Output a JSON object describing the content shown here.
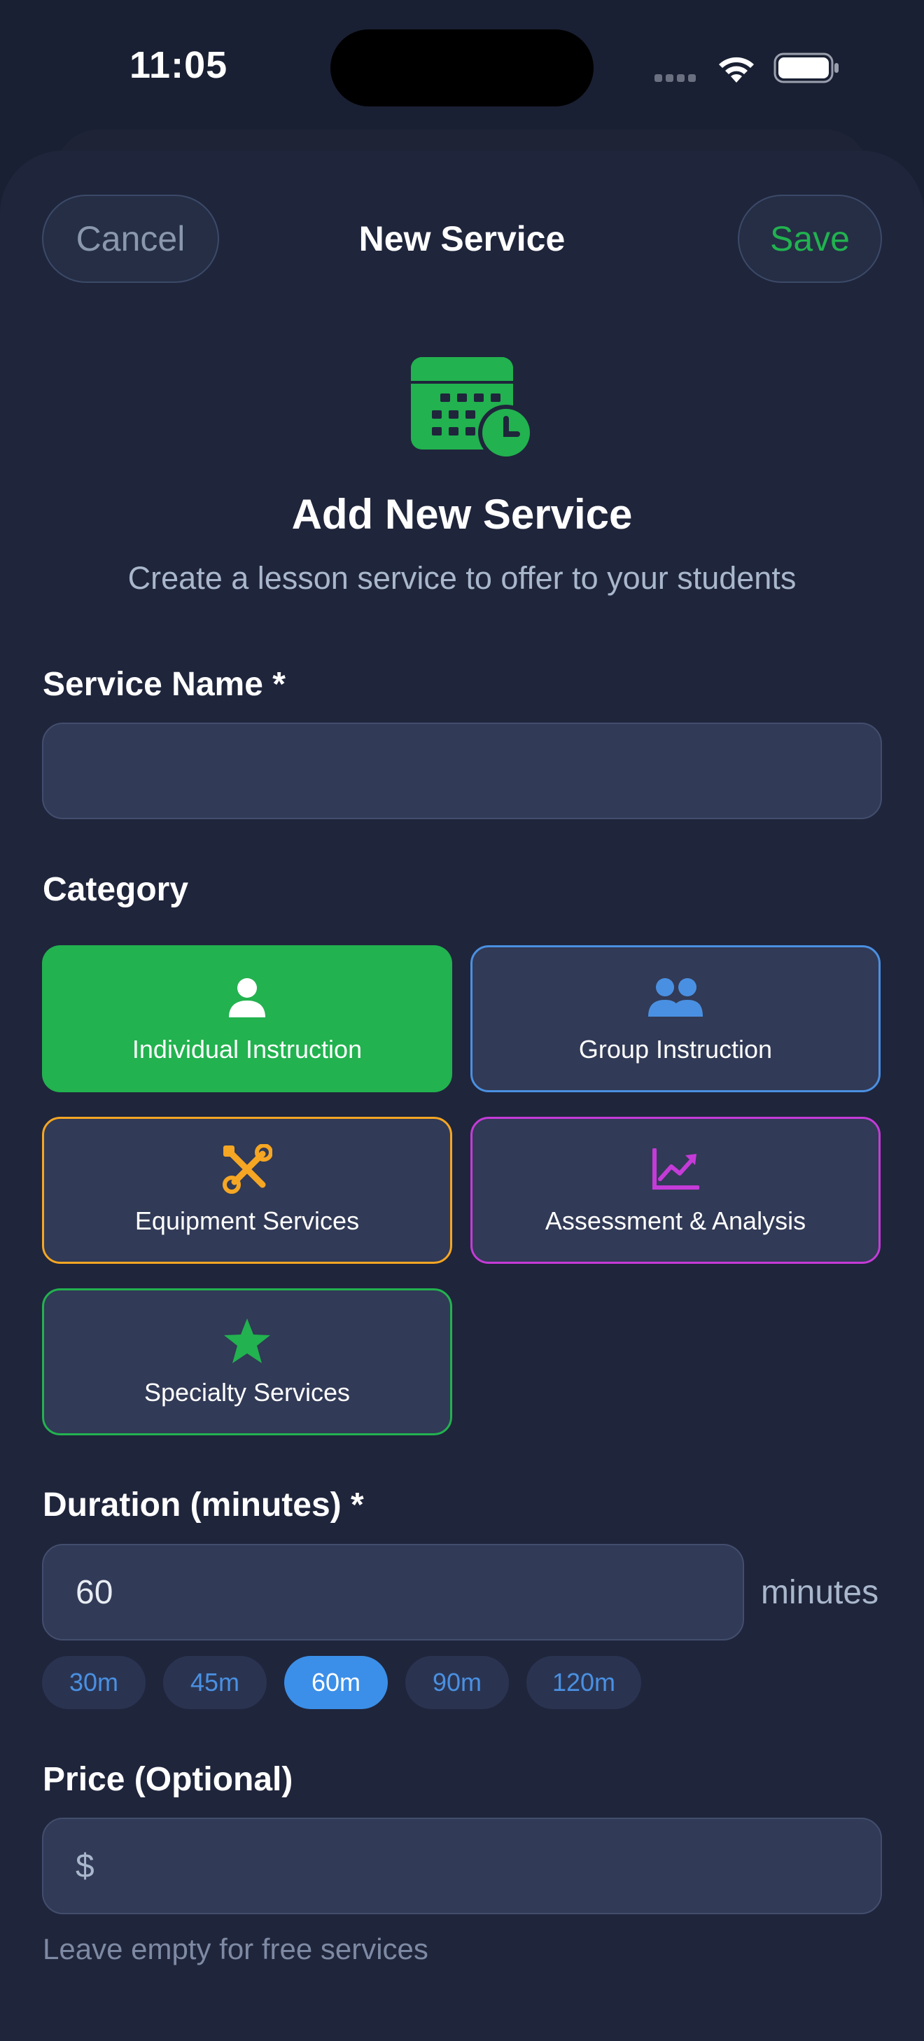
{
  "status": {
    "time": "11:05"
  },
  "nav": {
    "cancel": "Cancel",
    "title": "New Service",
    "save": "Save"
  },
  "hero": {
    "icon": "calendar-clock-icon",
    "title": "Add New Service",
    "subtitle": "Create a lesson service to offer to your students"
  },
  "service_name": {
    "label": "Service Name *",
    "value": ""
  },
  "category": {
    "label": "Category",
    "options": [
      {
        "label": "Individual Instruction",
        "icon": "person-icon",
        "color": "#22b24f",
        "selected": true
      },
      {
        "label": "Group Instruction",
        "icon": "people-icon",
        "color": "#4a90e2",
        "selected": false
      },
      {
        "label": "Equipment Services",
        "icon": "wrench-screwdriver-icon",
        "color": "#f5a623",
        "selected": false
      },
      {
        "label": "Assessment & Analysis",
        "icon": "chart-line-icon",
        "color": "#c53bd8",
        "selected": false
      },
      {
        "label": "Specialty Services",
        "icon": "star-icon",
        "color": "#22b24f",
        "selected": false
      }
    ]
  },
  "duration": {
    "label": "Duration (minutes) *",
    "value": "60",
    "unit": "minutes",
    "presets": [
      {
        "label": "30m",
        "selected": false
      },
      {
        "label": "45m",
        "selected": false
      },
      {
        "label": "60m",
        "selected": true
      },
      {
        "label": "90m",
        "selected": false
      },
      {
        "label": "120m",
        "selected": false
      }
    ]
  },
  "price": {
    "label": "Price (Optional)",
    "currency": "$",
    "value": "",
    "hint": "Leave empty for free services"
  },
  "colors": {
    "accent_green": "#22b24f",
    "accent_blue": "#3b8fe8",
    "background": "#1f253b"
  }
}
